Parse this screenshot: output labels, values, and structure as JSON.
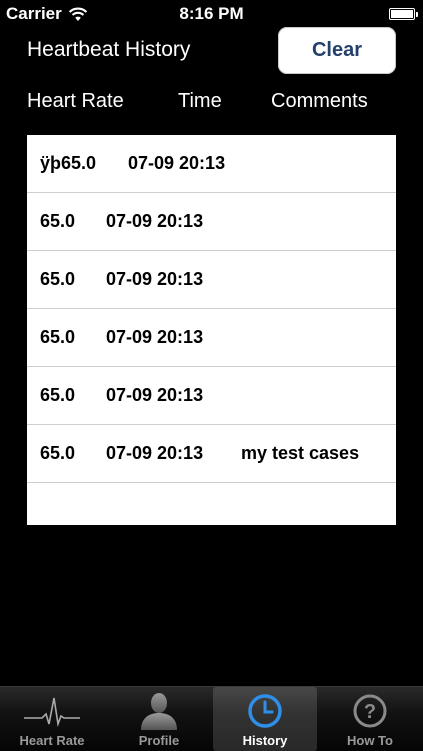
{
  "status": {
    "carrier": "Carrier",
    "time": "8:16 PM"
  },
  "header": {
    "title": "Heartbeat History",
    "clear_label": "Clear"
  },
  "columns": {
    "heart_rate": "Heart Rate",
    "time": "Time",
    "comments": "Comments"
  },
  "rows": [
    {
      "rate": "ÿþ65.0",
      "time": "07-09 20:13",
      "comment": ""
    },
    {
      "rate": "65.0",
      "time": "07-09 20:13",
      "comment": ""
    },
    {
      "rate": "65.0",
      "time": "07-09 20:13",
      "comment": ""
    },
    {
      "rate": "65.0",
      "time": "07-09 20:13",
      "comment": ""
    },
    {
      "rate": "65.0",
      "time": "07-09 20:13",
      "comment": ""
    },
    {
      "rate": "65.0",
      "time": "07-09 20:13",
      "comment": "my test cases"
    }
  ],
  "tabs": [
    {
      "label": "Heart Rate",
      "icon": "heart-rate-icon"
    },
    {
      "label": "Profile",
      "icon": "profile-icon"
    },
    {
      "label": "History",
      "icon": "history-clock-icon"
    },
    {
      "label": "How To",
      "icon": "help-icon"
    }
  ],
  "colors": {
    "accent": "#24406b",
    "history_icon": "#2f8fe8"
  }
}
